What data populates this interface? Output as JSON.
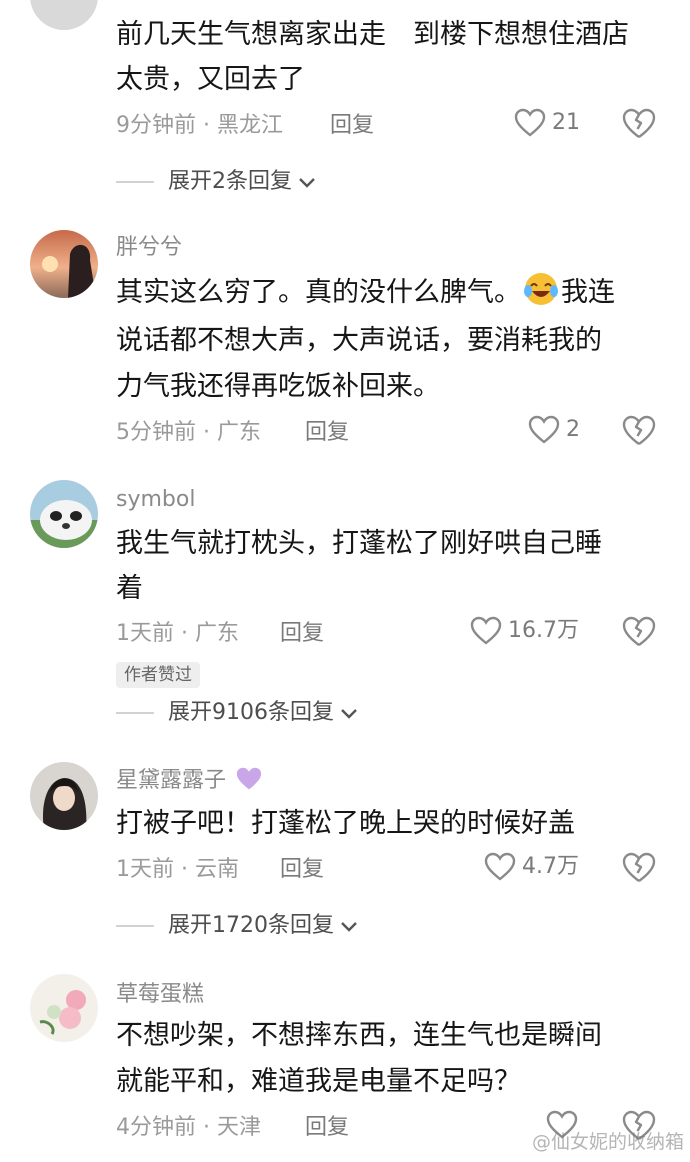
{
  "comments": [
    {
      "lines": [
        "前几天生气想离家出走　到楼下想想住酒店",
        "太贵，又回去了"
      ],
      "time_loc": "9分钟前 · 黑龙江",
      "reply": "回复",
      "likes": "21",
      "expand": "展开2条回复"
    },
    {
      "name": "胖兮兮",
      "lines": [
        "其实这么穷了。真的没什么脾气。",
        "我连",
        "说话都不想大声，大声说话，要消耗我的",
        "力气我还得再吃饭补回来。"
      ],
      "time_loc": "5分钟前 · 广东",
      "reply": "回复",
      "likes": "2"
    },
    {
      "name": "symbol",
      "lines": [
        "我生气就打枕头，打蓬松了刚好哄自己睡",
        "着"
      ],
      "time_loc": "1天前 · 广东",
      "reply": "回复",
      "likes": "16.7万",
      "badge": "作者赞过",
      "expand": "展开9106条回复"
    },
    {
      "name": "星黛露露子",
      "lines": [
        "打被子吧！打蓬松了晚上哭的时候好盖"
      ],
      "time_loc": "1天前 · 云南",
      "reply": "回复",
      "likes": "4.7万",
      "expand": "展开1720条回复"
    },
    {
      "name": "草莓蛋糕",
      "lines": [
        "不想吵架，不想摔东西，连生气也是瞬间",
        "就能平和，难道我是电量不足吗？"
      ],
      "time_loc": "4分钟前 · 天津",
      "reply": "回复",
      "likes": ""
    }
  ],
  "watermark": "@仙女妮的收纳箱",
  "colors": {
    "purple_heart": "#c9a6e8",
    "emoji_face": "#f7c034"
  }
}
